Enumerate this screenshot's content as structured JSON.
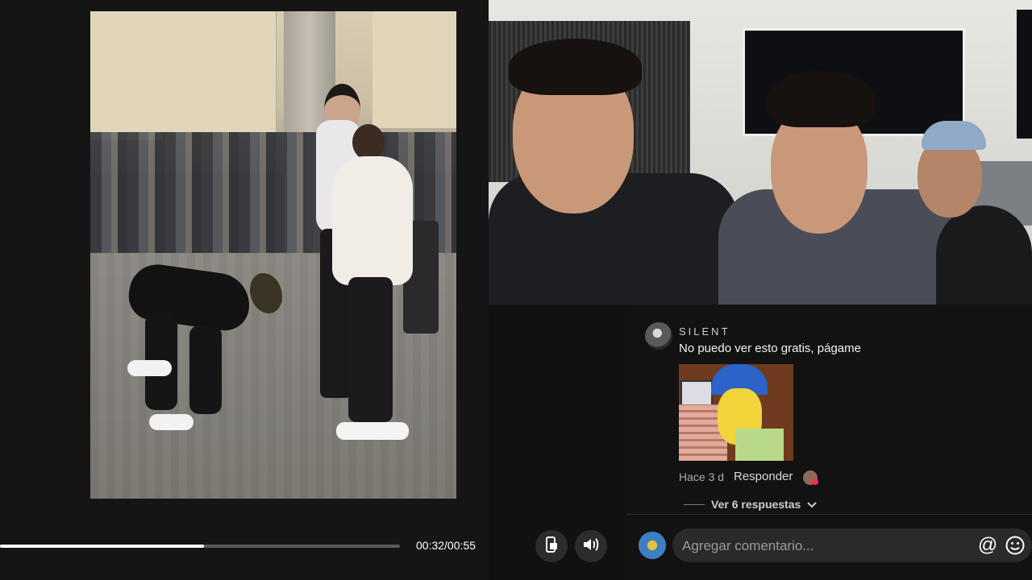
{
  "player": {
    "time_display": "00:32/00:55",
    "progress_fraction": 0.51
  },
  "controls": {
    "screen_icon": "phone-screen-icon",
    "volume_icon": "volume-icon"
  },
  "comment": {
    "username": "SILENT",
    "text": "No puedo ver esto gratis, págame",
    "time_ago": "Hace 3 d",
    "reply_label": "Responder",
    "view_replies_label": "Ver 6 respuestas"
  },
  "composer": {
    "placeholder": "Agregar comentario...",
    "mention_icon": "at-sign-icon",
    "emoji_icon": "emoji-icon"
  },
  "colors": {
    "background": "#111112",
    "accent": "#fe2c55"
  }
}
